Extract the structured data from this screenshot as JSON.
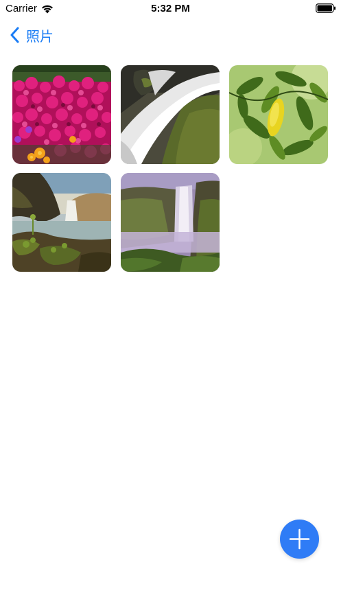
{
  "status_bar": {
    "carrier": "Carrier",
    "time": "5:32 PM"
  },
  "nav": {
    "back_label": "照片"
  },
  "photos": [
    {
      "subject": "pink-flowers"
    },
    {
      "subject": "waterfall-rocks"
    },
    {
      "subject": "lemon-leaves"
    },
    {
      "subject": "waterfall-cliff"
    },
    {
      "subject": "misty-waterfall"
    }
  ],
  "fab": {
    "icon": "plus-icon"
  },
  "colors": {
    "accent": "#1a7cf5",
    "fab": "#2f7cf6"
  }
}
